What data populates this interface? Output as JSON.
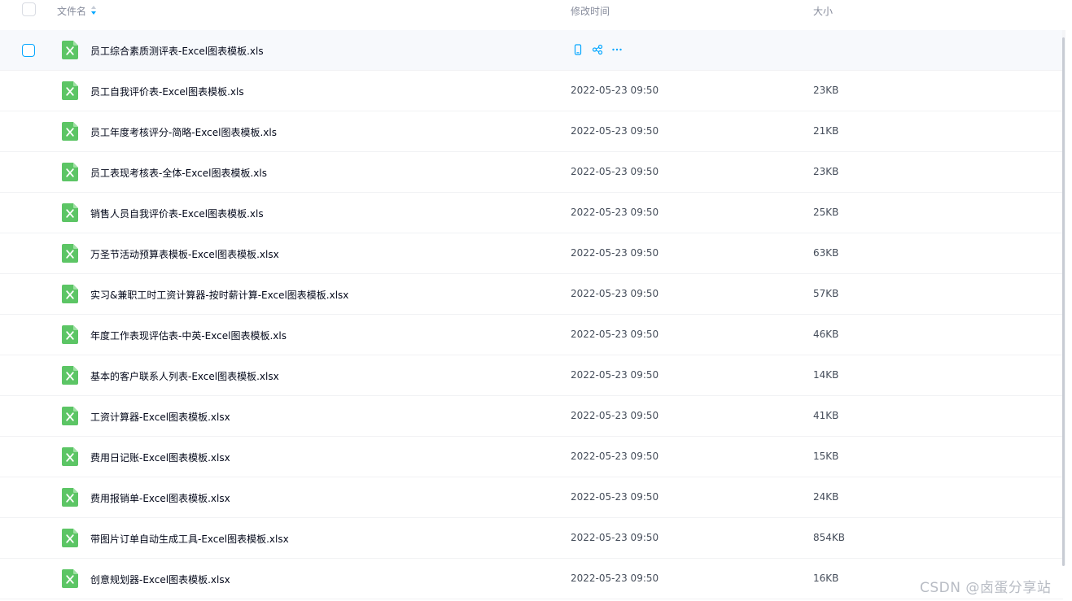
{
  "columns": {
    "name": "文件名",
    "modified": "修改时间",
    "size": "大小"
  },
  "icons": {
    "file_type": "excel-file-icon",
    "sort": "sort-ascending-icon",
    "phone": "phone-icon",
    "share": "share-icon",
    "more": "more-icon"
  },
  "colors": {
    "excel_green": "#5cc565",
    "accent_blue": "#06a7ff"
  },
  "files": [
    {
      "name": "员工综合素质测评表-Excel图表模板.xls",
      "modified": "",
      "size": "",
      "hovered": true
    },
    {
      "name": "员工自我评价表-Excel图表模板.xls",
      "modified": "2022-05-23 09:50",
      "size": "23KB"
    },
    {
      "name": "员工年度考核评分-简略-Excel图表模板.xls",
      "modified": "2022-05-23 09:50",
      "size": "21KB"
    },
    {
      "name": "员工表现考核表-全体-Excel图表模板.xls",
      "modified": "2022-05-23 09:50",
      "size": "23KB"
    },
    {
      "name": "销售人员自我评价表-Excel图表模板.xls",
      "modified": "2022-05-23 09:50",
      "size": "25KB"
    },
    {
      "name": "万圣节活动预算表模板-Excel图表模板.xlsx",
      "modified": "2022-05-23 09:50",
      "size": "63KB"
    },
    {
      "name": "实习&兼职工时工资计算器-按时薪计算-Excel图表模板.xlsx",
      "modified": "2022-05-23 09:50",
      "size": "57KB"
    },
    {
      "name": "年度工作表现评估表-中英-Excel图表模板.xls",
      "modified": "2022-05-23 09:50",
      "size": "46KB"
    },
    {
      "name": "基本的客户联系人列表-Excel图表模板.xlsx",
      "modified": "2022-05-23 09:50",
      "size": "14KB"
    },
    {
      "name": "工资计算器-Excel图表模板.xlsx",
      "modified": "2022-05-23 09:50",
      "size": "41KB"
    },
    {
      "name": "费用日记账-Excel图表模板.xlsx",
      "modified": "2022-05-23 09:50",
      "size": "15KB"
    },
    {
      "name": "费用报销单-Excel图表模板.xlsx",
      "modified": "2022-05-23 09:50",
      "size": "24KB"
    },
    {
      "name": "带图片订单自动生成工具-Excel图表模板.xlsx",
      "modified": "2022-05-23 09:50",
      "size": "854KB"
    },
    {
      "name": "创意规划器-Excel图表模板.xlsx",
      "modified": "2022-05-23 09:50",
      "size": "16KB"
    }
  ],
  "watermark": "CSDN @卤蛋分享站"
}
